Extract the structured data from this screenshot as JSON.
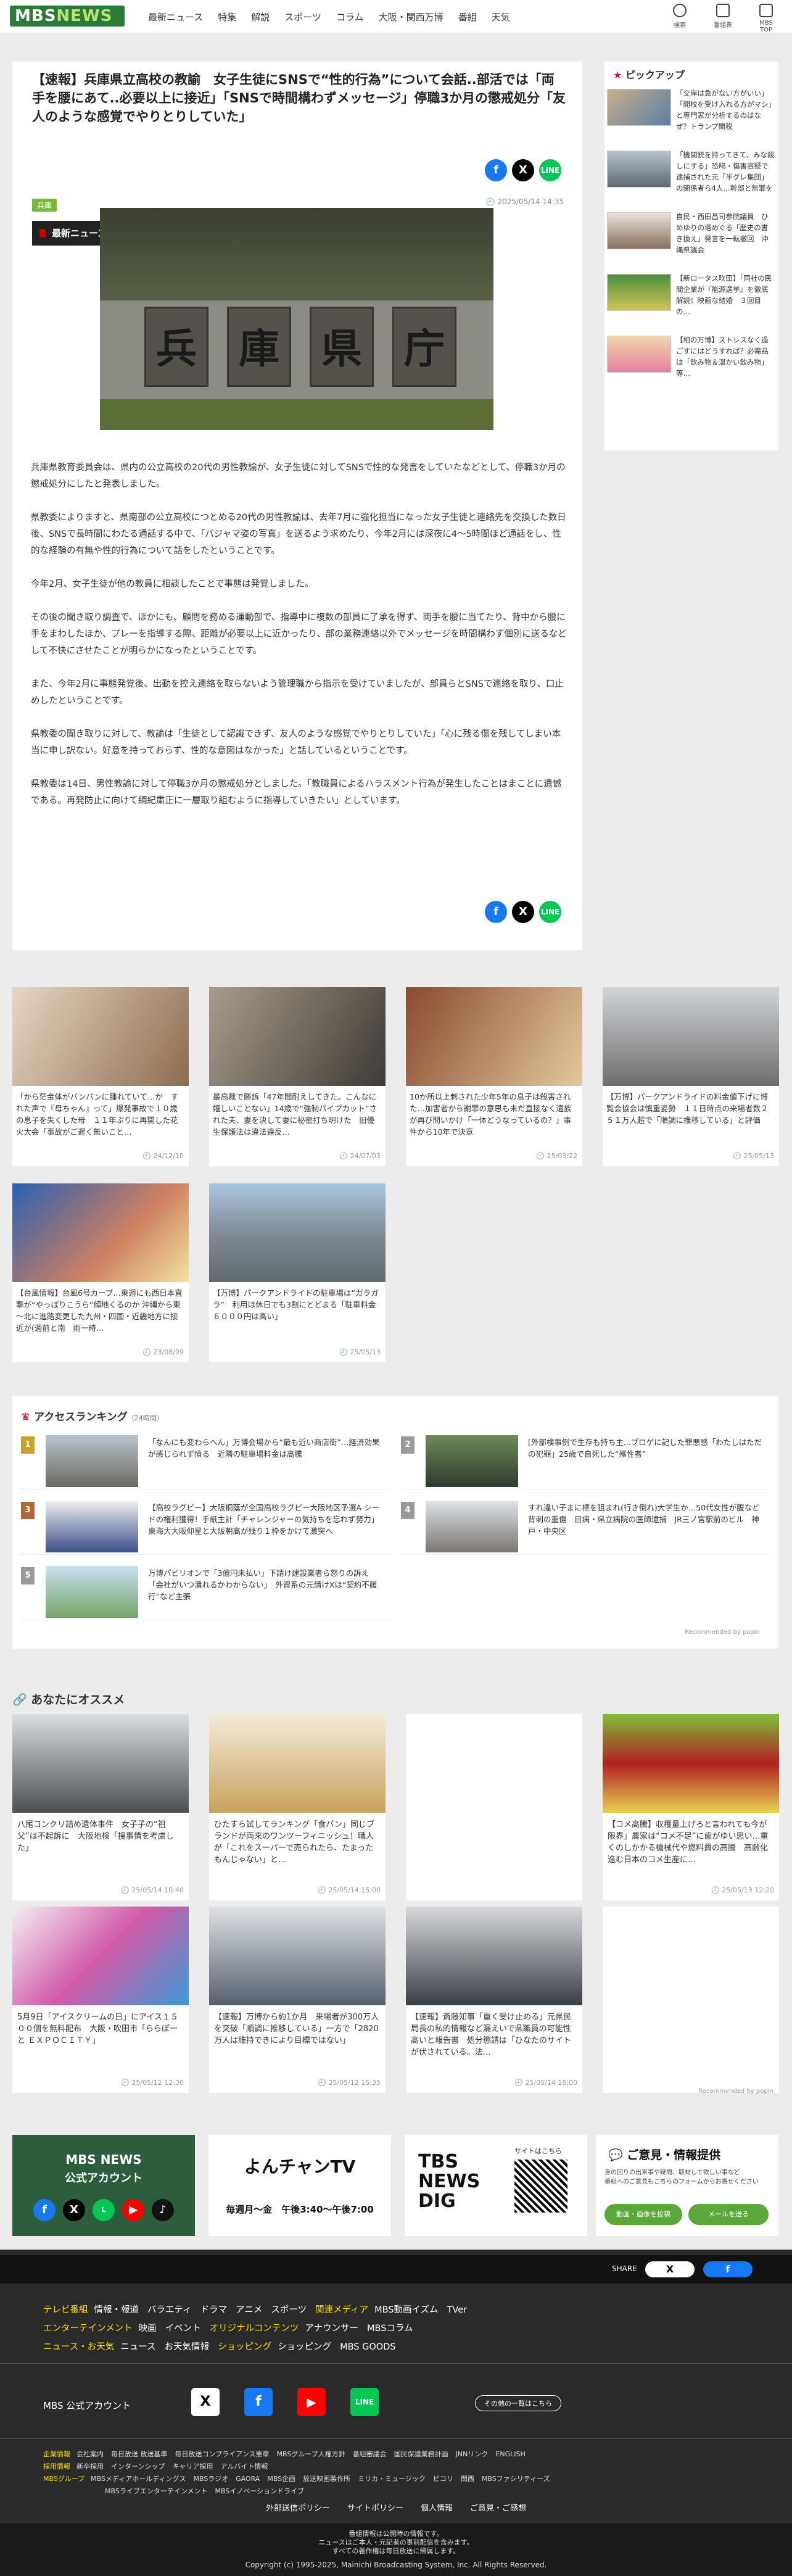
{
  "header": {
    "logo_prefix": "MBS",
    "logo_suffix": "NEWS",
    "nav": [
      "最新ニュース",
      "特集",
      "解説",
      "スポーツ",
      "コラム",
      "大阪・関西万博",
      "番組",
      "天気"
    ],
    "icons": [
      "検索",
      "番組表",
      "MBS TOP"
    ]
  },
  "article": {
    "title": "【速報】兵庫県立高校の教諭　女子生徒にSNSで“性的行為”について会話..部活では「両手を腰にあて..必要以上に接近」「SNSで時間構わずメッセージ」停職3か月の懲戒処分「友人のような感覚でやりとりしていた」",
    "tag": "兵庫",
    "date": "2025/05/14 14:35",
    "category": "最新ニュース",
    "photo_text": [
      "兵",
      "庫",
      "県",
      "庁"
    ],
    "paragraphs": [
      "兵庫県教育委員会は、県内の公立高校の20代の男性教諭が、女子生徒に対してSNSで性的な発言をしていたなどとして、停職3か月の懲戒処分にしたと発表しました。",
      "県教委によりますと、県南部の公立高校につとめる20代の男性教諭は、去年7月に強化担当になった女子生徒と連絡先を交換した数日後、SNSで長時間にわたる通話する中で、「パジャマ姿の写真」を送るよう求めたり、今年2月には深夜に4～5時間ほど通話をし、性的な経験の有無や性的行為について話をしたということです。",
      "今年2月、女子生徒が他の教員に相談したことで事態は発覚しました。",
      "その後の聞き取り調査で、ほかにも、顧問を務める運動部で、指導中に複数の部員に了承を得ず、両手を腰に当てたり、背中から腰に手をまわしたほか、プレーを指導する際、距離が必要以上に近かったり、部の業務連絡以外でメッセージを時間構わず個別に送るなどして不快にさせたことが明らかになったということです。",
      "また、今年2月に事態発覚後、出勤を控え連絡を取らないよう管理職から指示を受けていましたが、部員らとSNSで連絡を取り、口止めしたということです。",
      "県教委の聞き取りに対して、教諭は「生徒として認識できず、友人のような感覚でやりとりしていた」「心に残る傷を残してしまい本当に申し訳ない。好意を持っておらず、性的な意図はなかった」と話しているということです。",
      "県教委は14日、男性教諭に対して停職3か月の懲戒処分としました。「教職員によるハラスメント行為が発生したことはまことに遺憾である。再発防止に向けて綱紀粛正に一層取り組むように指導していきたい」としています。"
    ]
  },
  "pickup": {
    "title": "ピックアップ",
    "items": [
      "「交岸は急がない方がいい」「開校を受け入れる方がマシ」と専門家が分析するのはなぜ？トランプ関税",
      "「機関銃を持ってきて、みな殺しにする」恐喝・傷害容疑で逮捕された元「半グレ集団」の関係者ら4人…幹部と無罪を弁護した７３歳",
      "自民・西田昌司参院議員　ひめゆりの塔めぐる「歴史の書き換え」発言を一転撤回　沖縄県議会",
      "【新ロータス吹田】「同社の民間企業が『能源選挙』を徹底解説！映画な結婚　３回目の…",
      "【相の万博】ストレスなく過ごすにはどうすれば？必需品は「飲み物＆温かい飲み物」等…"
    ]
  },
  "related": [
    {
      "text": "「から茫金体がバンバンに腫れていて…か　すれた声で『母ちゃん』って」爆発事故で１０歳の息子を失くした母　１１年ぶりに再開した花火大会「事故がご遅く無いこと…",
      "date": "24/12/10"
    },
    {
      "text": "最高裁で勝訴「47年間耐えしてきた。こんなに嬉しいことない」14歳で“強制パイプカット”された夫、妻を決して妻に秘密打ち明けた　旧優生保護法は違法違反…",
      "date": "24/07/03"
    },
    {
      "text": "10か所以上刺された少年5年の息子は殺害された…加害者から謝罪の意思も未だ直接なく遺族が再び問いかけ「一体どうなっているの？」事件から10年で決意",
      "date": "25/03/22"
    },
    {
      "text": "【万博】パークアンドライドの料金値下げに博覧会協会は慎重姿勢　１１日時点の来場者数２５１万人超で「順調に推移している」と評価",
      "date": "25/05/13"
    },
    {
      "text": "【台風情報】台風6号カーブ…東週にも西日本直撃が“やっぱりこうら”傾地くるのか 沖縄から東～北に進路変更した九州・四国・近畿地方に接近が(週前と南　雨一時…",
      "date": "23/08/09"
    },
    {
      "text": "【万博】パークアンドライドの駐車場は“ガラガラ”　利用は休日でも3割にとどまる「駐車料金６０００円は高い」",
      "date": "25/05/13"
    }
  ],
  "ranking": {
    "title": "アクセスランキング",
    "subtitle": "（24時間）",
    "items": [
      {
        "no": "1",
        "text": "「なんにも変わらへん」万博会場から“最も近い商店街”…経済効果が感じられず憤る　近隣の駐車場料金は高騰"
      },
      {
        "no": "2",
        "text": "[外部検事例で生存も持ち主...プロゲに記した罪悪感「わたしはただの犯罪」25歳で自死した“殯性者”"
      },
      {
        "no": "3",
        "text": "【高校ラグビー】大阪桐蔭が全国高校ラグビー大阪地区予選A シードの権利獲得！手紙主計「チャレンジャーの気持ちを忘れず努力」　東海大大阪仰星と大阪朝高が残り１枠をかけて激突へ"
      },
      {
        "no": "4",
        "text": "すれ違い子まに標を狙まれ(行き倒れ)大学生か…50代女性が腹など背刺の重傷　目病・県立病院の医師逮捕　JR三ノ宮駅前のビル　神戸・中央区"
      },
      {
        "no": "5",
        "text": "万博パビリオンで「3億円未払い」下請け建設業者ら怒りの訴え「会社がいつ潰れるかわからない」　外資系の元請けXは“契約不履行”など主張"
      }
    ],
    "recommended": "Recommended by popIn"
  },
  "osusume": {
    "title": "あなたにオススメ",
    "items": [
      {
        "text": "八尾コンクリ詰め遺体事件　女子子の“祖父”は不起訴に　大阪地検「捜事情を考慮した」",
        "date": "25/05/14 10:40"
      },
      {
        "text": "ひたすら試してランキング「食パン」同じブランドが両来のワンツーフィニッシュ！職人が「これをスーパーで売られたら、たまったもんじゃない」と…",
        "date": "25/05/14 15:00"
      },
      {
        "text": "",
        "date": ""
      },
      {
        "text": "【コメ高騰】収穫量上げろと言われても今が限界」農家は“コメ不足”に歯がゆい思い…重くのしかかる機械代や燃料費の高騰　高齢化進む日本のコメ生産に…",
        "date": "25/05/13 12:20"
      },
      {
        "text": "5月9日「アイスクリームの日」にアイス１５００個を無料配布　大阪・吹田市「ららぽーと ＥＸＰＯＣＩＴＹ」",
        "date": "25/05/12 12:30"
      },
      {
        "text": "【速報】万博から約1か月　来場者が300万人を突破「順調に推移している」一方で「2820万人は維持できにより目標ではない」",
        "date": "25/05/12 15:35"
      },
      {
        "text": "【速報】斎藤知事「重く受け止める」元県民局長の私的情報など漏えいで県職員の可能性高いと報告書　処分懲請は「ひなたのサイトが伏されている。法…",
        "date": "25/05/14 16:00"
      },
      {
        "text": "",
        "date": ""
      }
    ],
    "recommended": "Recommended by popIn"
  },
  "banners": {
    "mbs": [
      "MBS NEWS",
      "公式アカウント"
    ],
    "yonchan": [
      "よんチャンTV",
      "毎週月～金　午後3:40～午後7:00"
    ],
    "tbs": [
      "TBS",
      "NEWS",
      "DIG",
      "サイトはこちら"
    ],
    "opinion": [
      "ご意見・情報提供",
      "身の回りの出来事や疑問、取材して欲しい事など",
      "番組へのご意見もこちらのフォームからお寄せください",
      "動画・画像を投稿",
      "メールを送る"
    ]
  },
  "sharebar": {
    "label": "SHARE"
  },
  "footer": {
    "rows": [
      {
        "head": "テレビ番組",
        "links": [
          "情報・報道",
          "バラエティ",
          "ドラマ",
          "アニメ",
          "スポーツ"
        ],
        "head2": "関連メディア",
        "links2": [
          "MBS動画イズム",
          "TVer"
        ]
      },
      {
        "head": "エンターテインメント",
        "links": [
          "映画",
          "イベント"
        ],
        "head2": "オリジナルコンテンツ",
        "links2": [
          "アナウンサー",
          "MBSコラム"
        ]
      },
      {
        "head": "ニュース・お天気",
        "links": [
          "ニュース",
          "お天気情報"
        ],
        "head2": "ショッピング",
        "links2": [
          "ショッピング",
          "MBS GOODS"
        ]
      }
    ],
    "official": "MBS 公式アカウント",
    "official_more": "その他の一覧はこちら",
    "corp": [
      {
        "head": "企業情報",
        "links": [
          "会社案内",
          "毎日放送 放送基準",
          "毎日放送コンプライアンス憲章",
          "MBSグループ人権方針",
          "番組審議会",
          "国民保護業務計画",
          "JNNリンク",
          "ENGLISH"
        ]
      },
      {
        "head": "採用情報",
        "links": [
          "新卒採用",
          "インターンシップ",
          "キャリア採用",
          "アルバイト情報"
        ]
      },
      {
        "head": "MBSグループ",
        "links": [
          "MBSメディアホールディングス",
          "MBSラジオ",
          "GAORA",
          "MBS企画",
          "放送映画製作所",
          "ミリカ・ミュージック",
          "ビコリ",
          "関西",
          "MBSファシリティーズ",
          "MBSライブエンターテインメント",
          "MBSイノベーションドライブ"
        ]
      }
    ],
    "bottom": [
      "外部送信ポリシー",
      "サイトポリシー",
      "個人情報",
      "ご意見・ご感想"
    ],
    "notice": [
      "番組情報は公開時の情報です。",
      "ニュースはご本人・元記者の事前配信を含みます。",
      "すべての著作権は毎日放送に帰属します。"
    ],
    "copyright": "Copyright (c) 1995-2025, Mainichi Broadcasting System, Inc. All Rights Reserved."
  }
}
